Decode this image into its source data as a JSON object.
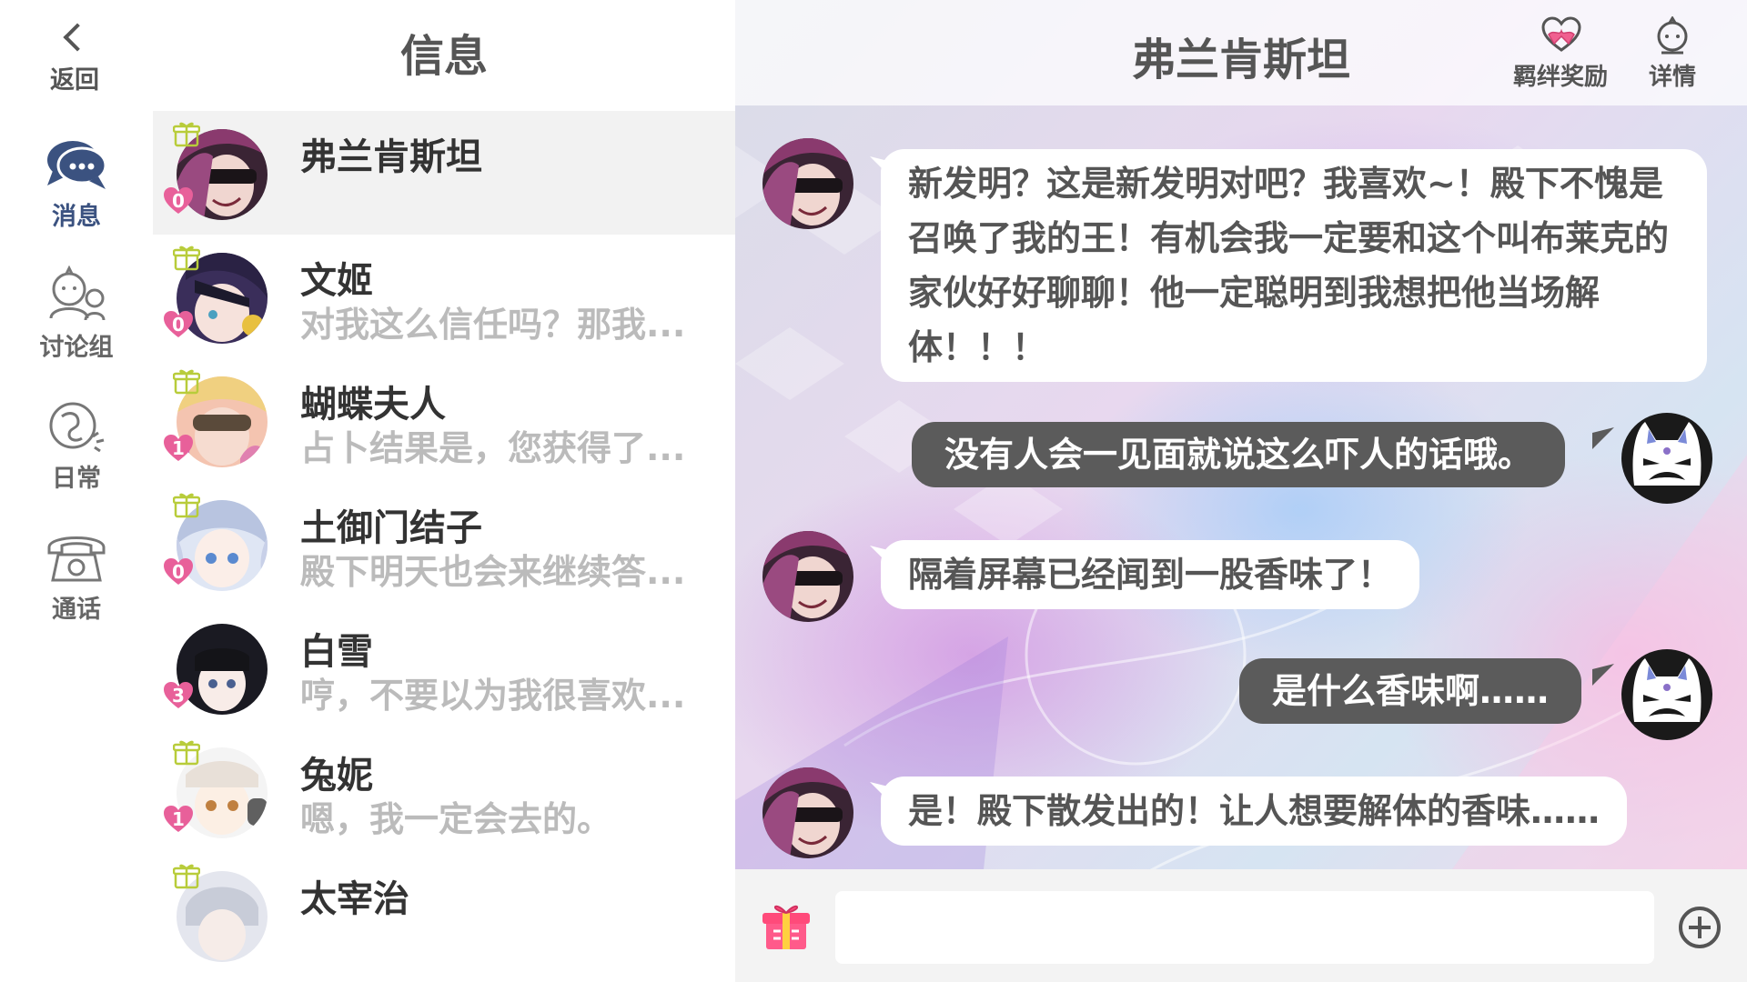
{
  "nav": {
    "back_label": "返回",
    "items": [
      {
        "label": "消息",
        "icon": "chat-bubble-icon",
        "active": true
      },
      {
        "label": "讨论组",
        "icon": "group-icon",
        "active": false
      },
      {
        "label": "日常",
        "icon": "moments-icon",
        "active": false
      },
      {
        "label": "通话",
        "icon": "telephone-icon",
        "active": false
      }
    ]
  },
  "list": {
    "title": "信息",
    "conversations": [
      {
        "name": "弗兰肯斯坦",
        "preview": "",
        "badge": "0",
        "selected": true
      },
      {
        "name": "文姬",
        "preview": "对我这么信任吗？那我...",
        "badge": "0"
      },
      {
        "name": "蝴蝶夫人",
        "preview": "占卜结果是，您获得了...",
        "badge": "1"
      },
      {
        "name": "土御门结子",
        "preview": "殿下明天也会来继续答...",
        "badge": "0"
      },
      {
        "name": "白雪",
        "preview": "哼，不要以为我很喜欢...",
        "badge": "3"
      },
      {
        "name": "兔妮",
        "preview": "嗯，我一定会去的。",
        "badge": "1"
      },
      {
        "name": "太宰治",
        "preview": "",
        "badge": ""
      }
    ]
  },
  "chat": {
    "title": "弗兰肯斯坦",
    "bond_reward_label": "羁绊奖励",
    "details_label": "详情",
    "messages": [
      {
        "from": "them",
        "text": "新发明？这是新发明对吧？我喜欢~！殿下不愧是召唤了我的王！有机会我一定要和这个叫布莱克的家伙好好聊聊！他一定聪明到我想把他当场解体！！！"
      },
      {
        "from": "me",
        "text": "没有人会一见面就说这么吓人的话哦。"
      },
      {
        "from": "them",
        "text": "隔着屏幕已经闻到一股香味了！"
      },
      {
        "from": "me",
        "text": "是什么香味啊……"
      },
      {
        "from": "them",
        "text": "是！殿下散发出的！让人想要解体的香味……"
      }
    ],
    "input_placeholder": ""
  },
  "colors": {
    "accent_nav": "#3b5280",
    "heart_badge": "#e8609a",
    "gift_badge": "#c9d84a",
    "outgoing_bubble": "#5b5b5b",
    "incoming_bubble": "#ffffff"
  }
}
